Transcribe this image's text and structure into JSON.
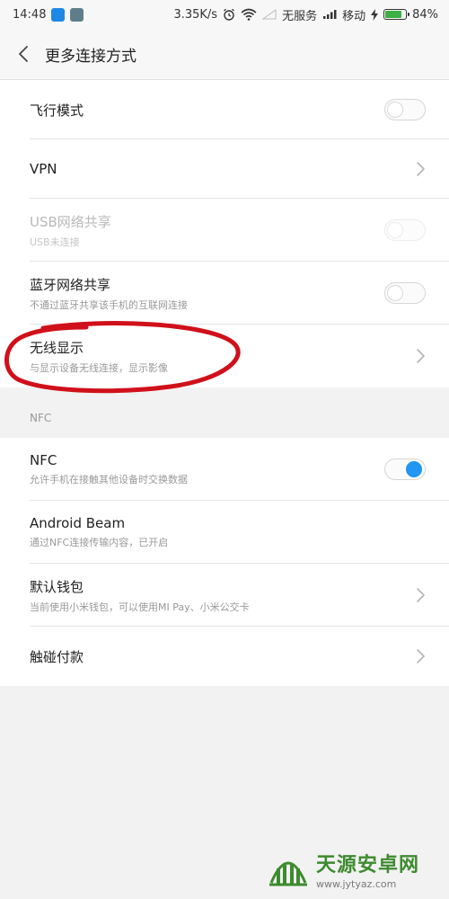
{
  "status_bar": {
    "time": "14:48",
    "speed": "3.35K/s",
    "no_service": "无服务",
    "carrier": "移动",
    "battery": "84%",
    "battery_level": 0.84
  },
  "header": {
    "title": "更多连接方式"
  },
  "sections": {
    "connections": [
      {
        "title": "飞行模式",
        "subtitle": "",
        "control": "toggle",
        "state": "off"
      },
      {
        "title": "VPN",
        "subtitle": "",
        "control": "chevron"
      },
      {
        "title": "USB网络共享",
        "subtitle": "USB未连接",
        "control": "toggle",
        "state": "off",
        "disabled": true
      },
      {
        "title": "蓝牙网络共享",
        "subtitle": "不通过蓝牙共享该手机的互联网连接",
        "control": "toggle",
        "state": "off"
      },
      {
        "title": "无线显示",
        "subtitle": "与显示设备无线连接，显示影像",
        "control": "chevron"
      }
    ],
    "nfc_header": "NFC",
    "nfc": [
      {
        "title": "NFC",
        "subtitle": "允许手机在接触其他设备时交换数据",
        "control": "toggle",
        "state": "on"
      },
      {
        "title": "Android Beam",
        "subtitle": "通过NFC连接传输内容，已开启",
        "control": "none"
      },
      {
        "title": "默认钱包",
        "subtitle": "当前使用小米钱包，可以使用MI Pay、小米公交卡",
        "control": "chevron"
      },
      {
        "title": "触碰付款",
        "subtitle": "",
        "control": "chevron"
      }
    ]
  },
  "colors": {
    "accent": "#2196f3",
    "annotation": "#d0101a",
    "watermark": "#3d8b2f"
  },
  "watermark": {
    "title": "天源安卓网",
    "url": "www.jytyaz.com"
  }
}
